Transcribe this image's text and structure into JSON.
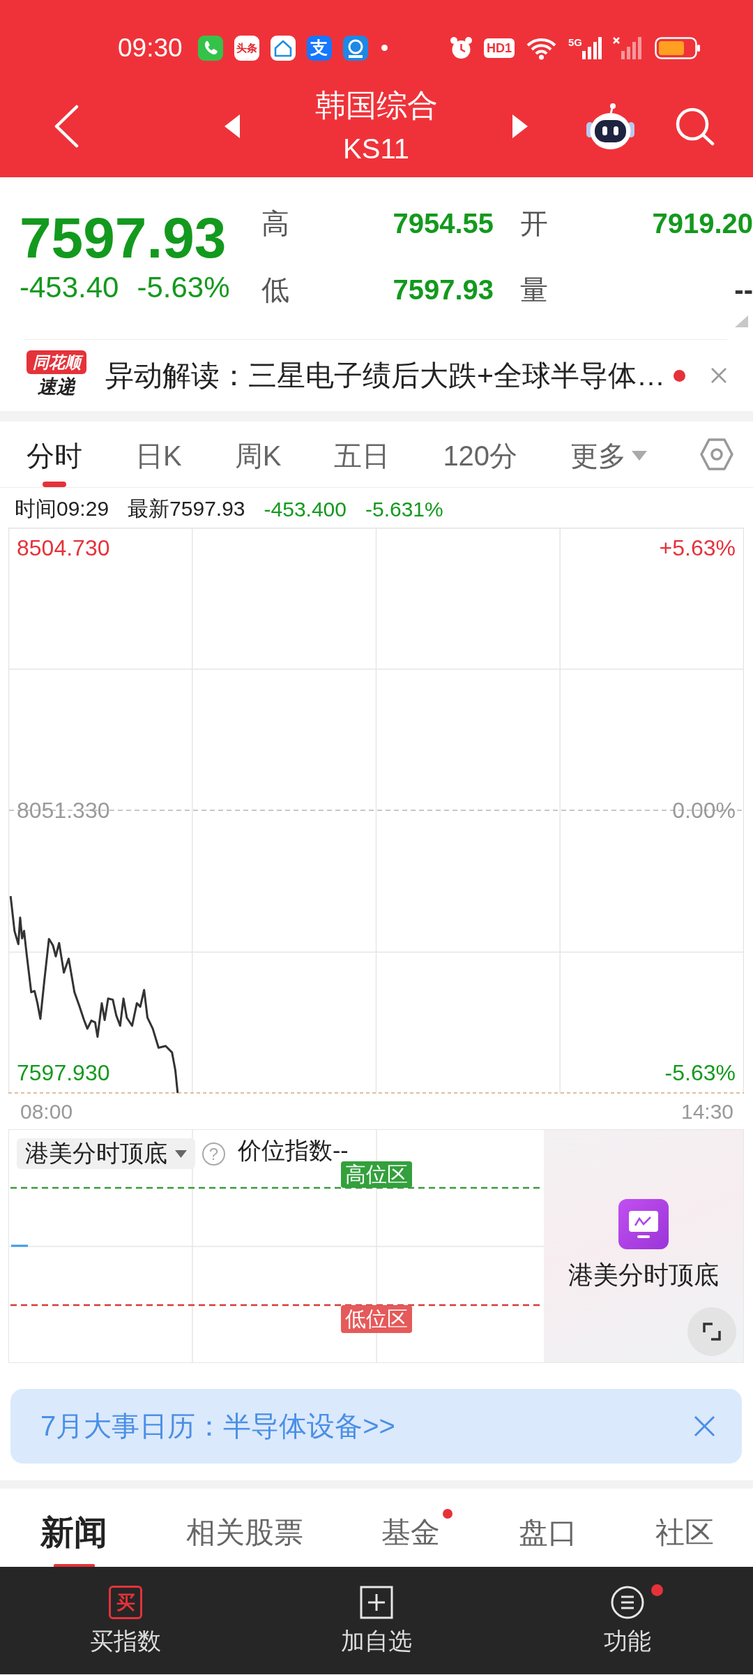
{
  "status_bar": {
    "time": "09:30",
    "notification_icons": [
      {
        "kind": "phone"
      },
      {
        "kind": "news",
        "text": "头条"
      },
      {
        "kind": "home"
      },
      {
        "kind": "pay",
        "text": "支"
      },
      {
        "kind": "globe"
      }
    ],
    "hd_label": "HD1",
    "network_label": "5G"
  },
  "header": {
    "title": "韩国综合",
    "code": "KS11"
  },
  "quote": {
    "price": "7597.93",
    "change": "-453.40",
    "change_pct": "-5.63%",
    "falling": true,
    "stats": [
      {
        "label": "高",
        "value": "7954.55",
        "falling": true
      },
      {
        "label": "开",
        "value": "7919.20",
        "falling": true
      },
      {
        "label": "低",
        "value": "7597.93",
        "falling": true
      },
      {
        "label": "量",
        "value": "--",
        "falling": false
      }
    ]
  },
  "news_ticker": {
    "logo_top": "同花顺",
    "logo_bottom": "速递",
    "text": "异动解读：三星电子绩后大跌+全球半导体…",
    "unread": true
  },
  "period_tabs": [
    {
      "label": "分时",
      "selected": true,
      "kind": "period"
    },
    {
      "label": "日K",
      "selected": false,
      "kind": "period"
    },
    {
      "label": "周K",
      "selected": false,
      "kind": "period"
    },
    {
      "label": "五日",
      "selected": false,
      "kind": "period"
    },
    {
      "label": "120分",
      "selected": false,
      "kind": "period"
    },
    {
      "label": "更多",
      "selected": false,
      "kind": "menu"
    }
  ],
  "quote_line": {
    "time": "时间09:29",
    "latest": "最新7597.93",
    "change": "-453.400",
    "change_pct": "-5.631%"
  },
  "intraday_chart": {
    "percent_labels": [
      "+5.63%",
      "0.00%",
      "-5.63%"
    ],
    "chart_data": {
      "type": "line",
      "x": [
        7.648,
        7.686,
        7.724,
        7.742,
        7.761,
        7.78,
        7.804,
        7.851,
        7.884,
        7.912,
        7.941,
        7.979,
        8.025,
        8.064,
        8.092,
        8.125,
        8.172,
        8.219,
        8.276,
        8.323,
        8.37,
        8.403,
        8.442,
        8.479,
        8.503,
        8.545,
        8.573,
        8.607,
        8.653,
        8.687,
        8.725,
        8.758,
        8.791,
        8.843,
        8.89,
        8.923,
        8.961,
        8.994,
        9.046,
        9.103,
        9.173,
        9.235,
        9.268,
        9.291
      ],
      "series": [
        {
          "color": "#333333",
          "values": [
            7903,
            7843,
            7820,
            7866,
            7830,
            7843,
            7805,
            7737,
            7739,
            7718,
            7691,
            7756,
            7829,
            7818,
            7799,
            7822,
            7771,
            7795,
            7737,
            7714,
            7689,
            7674,
            7688,
            7685,
            7660,
            7718,
            7689,
            7726,
            7724,
            7697,
            7679,
            7726,
            7693,
            7679,
            7718,
            7712,
            7741,
            7693,
            7674,
            7641,
            7644,
            7633,
            7602,
            7563
          ]
        }
      ],
      "xlim": [
        7.626,
        14.86
      ],
      "ylim": [
        7561.75,
        8539.7
      ],
      "xticks": [
        {
          "value": 8,
          "label": "08:00"
        },
        {
          "value": 14.5,
          "label": "14:30"
        }
      ],
      "yticks": [
        {
          "value": 8504.73,
          "label": "8504.730"
        },
        {
          "value": 8051.33,
          "label": "8051.330"
        },
        {
          "value": 7597.93,
          "label": "7597.930"
        }
      ]
    }
  },
  "indicator": {
    "selector": "港美分时顶底",
    "help_icon": "?",
    "title": "价位指数--",
    "zones": [
      {
        "label": "高位区",
        "kind": "high"
      },
      {
        "label": "低位区",
        "kind": "low"
      }
    ],
    "promo_label": "港美分时顶底"
  },
  "banner": {
    "text": "7月大事日历：半导体设备>>"
  },
  "content_tabs": [
    {
      "label": "新闻",
      "selected": true,
      "dot": false
    },
    {
      "label": "相关股票",
      "selected": false,
      "dot": false
    },
    {
      "label": "基金",
      "selected": false,
      "dot": true
    },
    {
      "label": "盘口",
      "selected": false,
      "dot": false
    },
    {
      "label": "社区",
      "selected": false,
      "dot": false
    }
  ],
  "bottom_nav": [
    {
      "label": "买指数",
      "kind": "buy",
      "icon_text": "买",
      "dot": false
    },
    {
      "label": "加自选",
      "kind": "add",
      "dot": false
    },
    {
      "label": "功能",
      "kind": "menu",
      "dot": true
    }
  ]
}
